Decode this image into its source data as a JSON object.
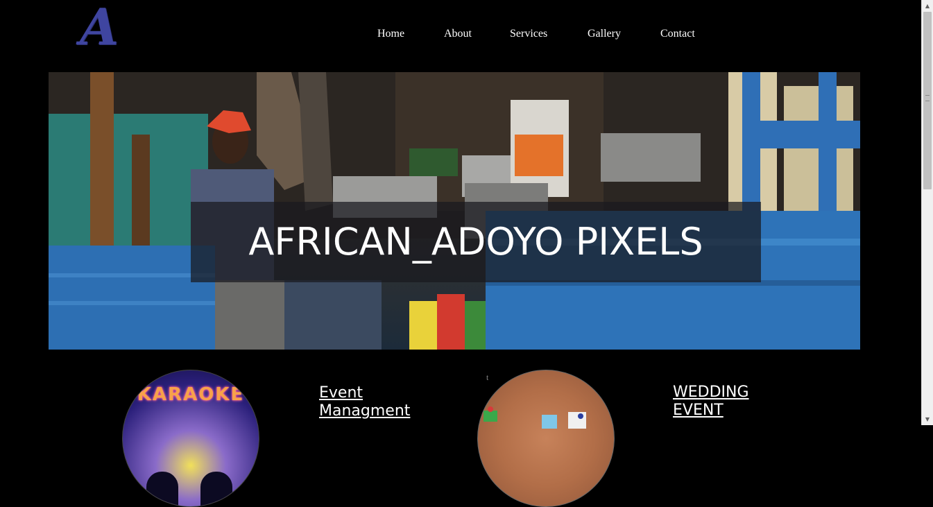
{
  "logo": {
    "letter": "A"
  },
  "nav": {
    "items": [
      {
        "label": "Home"
      },
      {
        "label": "About"
      },
      {
        "label": "Services"
      },
      {
        "label": "Gallery"
      },
      {
        "label": "Contact"
      }
    ]
  },
  "hero": {
    "title": "AFRICAN_ADOYO PIXELS"
  },
  "services": {
    "karaoke_text": "KARAOKE",
    "stray_char": "t",
    "event_management": {
      "line1": "Event",
      "line2": "Managment"
    },
    "wedding_event": {
      "line1": "WEDDING",
      "line2": "EVENT"
    }
  },
  "colors": {
    "background": "#000000",
    "logo": "#3f45a0",
    "nav_text": "#ffffff",
    "banner_overlay": "rgba(25,25,30,0.72)",
    "scrollbar_track": "#f0f0f0",
    "scrollbar_thumb": "#c1c1c1"
  },
  "scrollbar": {
    "up_icon": "triangle-up",
    "down_icon": "triangle-down"
  }
}
